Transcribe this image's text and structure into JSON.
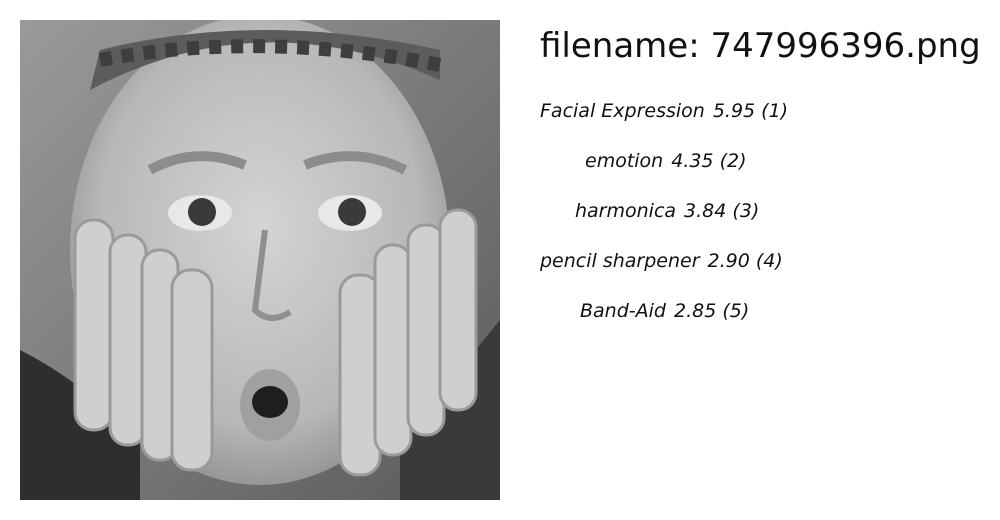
{
  "header": {
    "prefix": "filename:",
    "filename": "747996396.png"
  },
  "predictions": [
    {
      "label": "Facial Expression",
      "score": "5.95",
      "rank": "(1)"
    },
    {
      "label": "emotion",
      "score": "4.35",
      "rank": "(2)"
    },
    {
      "label": "harmonica",
      "score": "3.84",
      "rank": "(3)"
    },
    {
      "label": "pencil sharpener",
      "score": "2.90",
      "rank": "(4)"
    },
    {
      "label": "Band-Aid",
      "score": "2.85",
      "rank": "(5)"
    }
  ],
  "photo": {
    "description_icon": "surprised-child-face-photo"
  }
}
